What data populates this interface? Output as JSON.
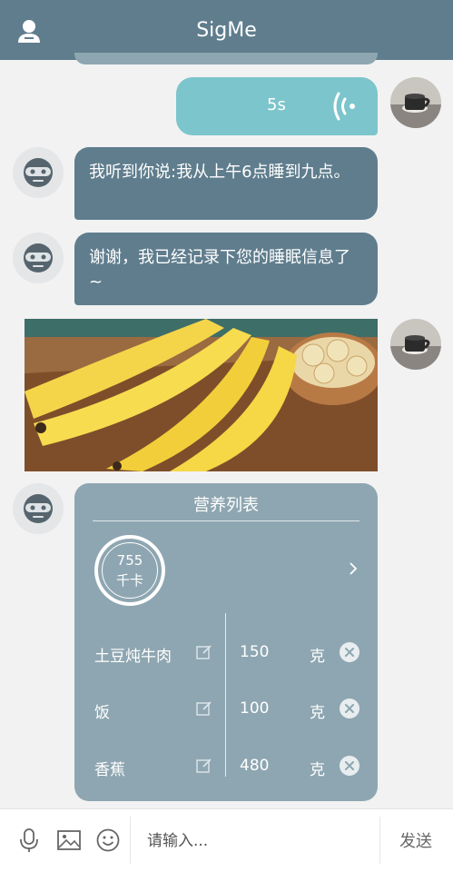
{
  "header": {
    "title": "SigMe",
    "profile_icon": "person-icon"
  },
  "messages": {
    "voice": {
      "duration": "5s",
      "icon": "voice-wave-icon"
    },
    "bot_reply_1": "我听到你说:我从上午6点睡到九点。",
    "bot_reply_2": "谢谢，我已经记录下您的睡眠信息了~",
    "photo": {
      "subject": "bananas"
    }
  },
  "nutrition": {
    "title": "营养列表",
    "calories_value": "755",
    "calories_unit": "千卡",
    "items": [
      {
        "name": "土豆炖牛肉",
        "amount": "150",
        "unit": "克"
      },
      {
        "name": "饭",
        "amount": "100",
        "unit": "克"
      },
      {
        "name": "香蕉",
        "amount": "480",
        "unit": "克"
      }
    ]
  },
  "input_bar": {
    "placeholder": "请输入...",
    "send_label": "发送",
    "icons": [
      "microphone-icon",
      "image-icon",
      "emoji-icon"
    ]
  },
  "colors": {
    "header_bg": "#5f7d8d",
    "bot_bubble": "#5f7d8d",
    "user_bubble": "#7cc5cc",
    "card_bg": "#8ea6b1",
    "page_bg": "#f2f2f2"
  }
}
